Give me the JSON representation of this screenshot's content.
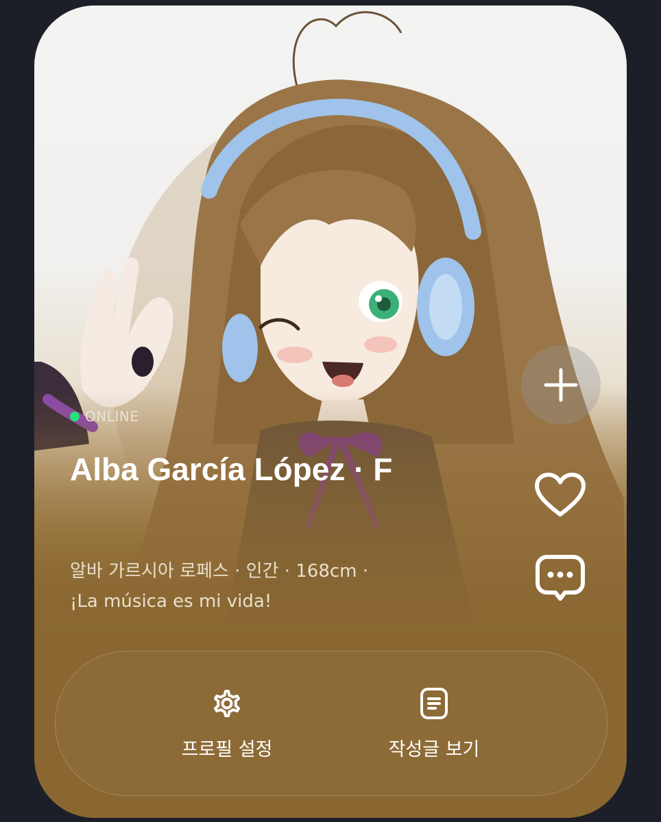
{
  "profile": {
    "status": "ONLINE",
    "name": "Alba García López · F",
    "description": "알바 가르시아 로페스 · 인간 · 168cm · ¡La música es mi vida!"
  },
  "side_actions": {
    "add_icon": "plus-icon",
    "like_icon": "heart-icon",
    "message_icon": "chat-bubble-icon"
  },
  "bottom_actions": [
    {
      "label": "프로필 설정",
      "icon": "gear-icon"
    },
    {
      "label": "작성글 보기",
      "icon": "document-icon"
    }
  ],
  "colors": {
    "page_background": "#1c1f27",
    "card_bottom": "#8a6731",
    "online_dot": "#29e07a"
  }
}
